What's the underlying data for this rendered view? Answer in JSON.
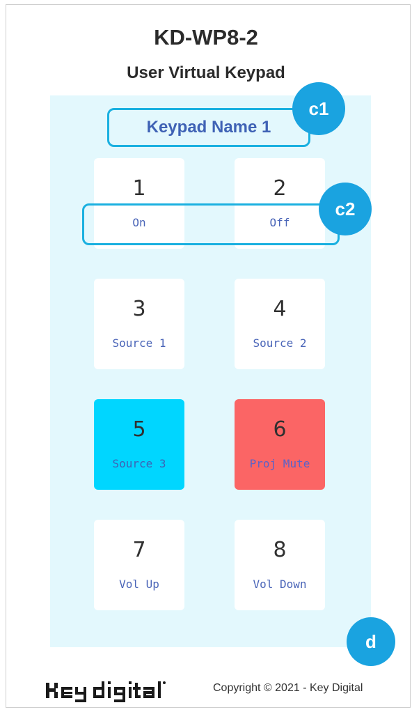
{
  "header": {
    "model": "KD-WP8-2",
    "subtitle": "User Virtual Keypad"
  },
  "keypad_name": "Keypad Name 1",
  "keys": [
    {
      "number": "1",
      "label": "On"
    },
    {
      "number": "2",
      "label": "Off"
    },
    {
      "number": "3",
      "label": "Source 1"
    },
    {
      "number": "4",
      "label": "Source 2"
    },
    {
      "number": "5",
      "label": "Source 3"
    },
    {
      "number": "6",
      "label": "Proj Mute"
    },
    {
      "number": "7",
      "label": "Vol Up"
    },
    {
      "number": "8",
      "label": "Vol Down"
    }
  ],
  "key_colors": {
    "default": "#ffffff",
    "5": "#00d6ff",
    "6": "#fb6565"
  },
  "callouts": {
    "c1": "c1",
    "c2": "c2",
    "d": "d"
  },
  "callout_color": "#1aa3e0",
  "footer": {
    "logo_text": "Key digital",
    "copyright": "Copyright © 2021 - Key Digital"
  }
}
